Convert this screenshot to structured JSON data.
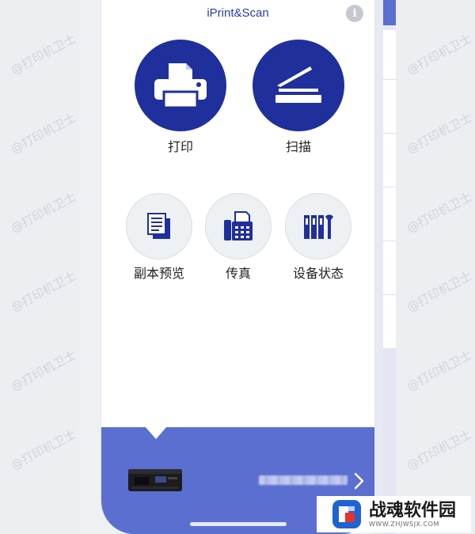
{
  "header": {
    "title": "iPrint&Scan",
    "info_icon": "i"
  },
  "main_actions": [
    {
      "label": "打印",
      "icon": "printer-icon"
    },
    {
      "label": "扫描",
      "icon": "scanner-icon"
    }
  ],
  "secondary_actions": [
    {
      "label": "副本预览",
      "icon": "copy-preview-icon"
    },
    {
      "label": "传真",
      "icon": "fax-icon"
    },
    {
      "label": "设备状态",
      "icon": "device-status-icon"
    }
  ],
  "footer": {
    "printer_name": "",
    "chevron": "›"
  },
  "watermark": "@打印机卫士",
  "badge": {
    "name": "战魂软件园",
    "url": "WWW.ZHJWSJX.COM"
  },
  "colors": {
    "primary": "#1f2f9c",
    "footer": "#5a6fd0",
    "title": "#2b3c9e",
    "secondary_bg": "#eef1f3"
  }
}
